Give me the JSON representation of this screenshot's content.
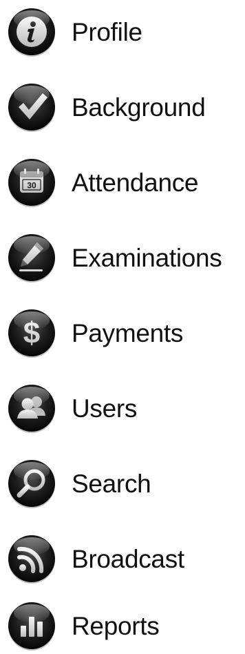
{
  "menu": {
    "items": [
      {
        "label": "Profile",
        "icon": "info-icon"
      },
      {
        "label": "Background",
        "icon": "checkmark-icon"
      },
      {
        "label": "Attendance",
        "icon": "calendar-icon"
      },
      {
        "label": "Examinations",
        "icon": "pencil-icon"
      },
      {
        "label": "Payments",
        "icon": "dollar-icon"
      },
      {
        "label": "Users",
        "icon": "users-icon"
      },
      {
        "label": "Search",
        "icon": "search-icon"
      },
      {
        "label": "Broadcast",
        "icon": "rss-icon"
      },
      {
        "label": "Reports",
        "icon": "bar-chart-icon"
      }
    ],
    "calendar_day": "30",
    "colors": {
      "icon_dark": "#0a0a0a",
      "icon_mid": "#3a3a3a",
      "icon_glyph": "#e6e6e6",
      "label_text": "#111111"
    }
  }
}
